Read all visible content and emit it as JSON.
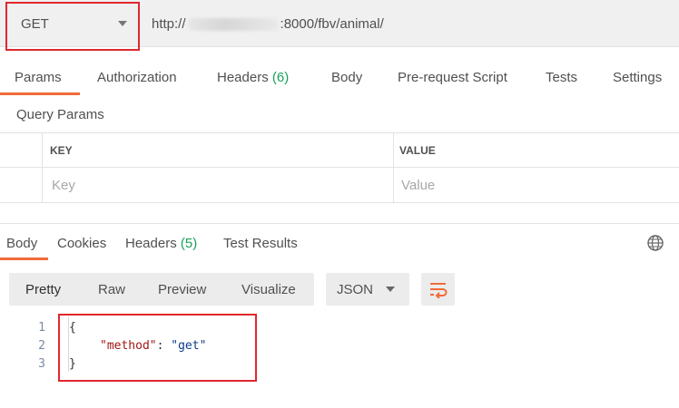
{
  "request": {
    "method": "GET",
    "url_prefix": "http://",
    "url_suffix": ":8000/fbv/animal/"
  },
  "request_tabs": [
    {
      "label": "Params",
      "count": ""
    },
    {
      "label": "Authorization",
      "count": ""
    },
    {
      "label": "Headers",
      "count": "(6)"
    },
    {
      "label": "Body",
      "count": ""
    },
    {
      "label": "Pre-request Script",
      "count": ""
    },
    {
      "label": "Tests",
      "count": ""
    },
    {
      "label": "Settings",
      "count": ""
    }
  ],
  "active_request_tab": "Params",
  "query_params": {
    "title": "Query Params",
    "headers": [
      "KEY",
      "VALUE"
    ],
    "placeholders": [
      "Key",
      "Value"
    ]
  },
  "response_tabs": [
    {
      "label": "Body",
      "count": ""
    },
    {
      "label": "Cookies",
      "count": ""
    },
    {
      "label": "Headers",
      "count": "(5)"
    },
    {
      "label": "Test Results",
      "count": ""
    }
  ],
  "active_response_tab": "Body",
  "response_toolbar": {
    "formats": [
      "Pretty",
      "Raw",
      "Preview",
      "Visualize"
    ],
    "active_format": "Pretty",
    "language": "JSON",
    "icons": [
      "globe-icon",
      "wrap-lines-icon",
      "chevron-down-icon"
    ]
  },
  "response_body": {
    "line_numbers": [
      "1",
      "2",
      "3"
    ],
    "open_brace": "{",
    "key": "\"method\"",
    "separator": ": ",
    "value": "\"get\"",
    "close_brace": "}"
  },
  "colors": {
    "accent": "#f26b3a",
    "count_green": "#1aa05a",
    "annotation_red": "#e0282e",
    "json_key": "#a31515",
    "json_value": "#0b3b8c"
  }
}
